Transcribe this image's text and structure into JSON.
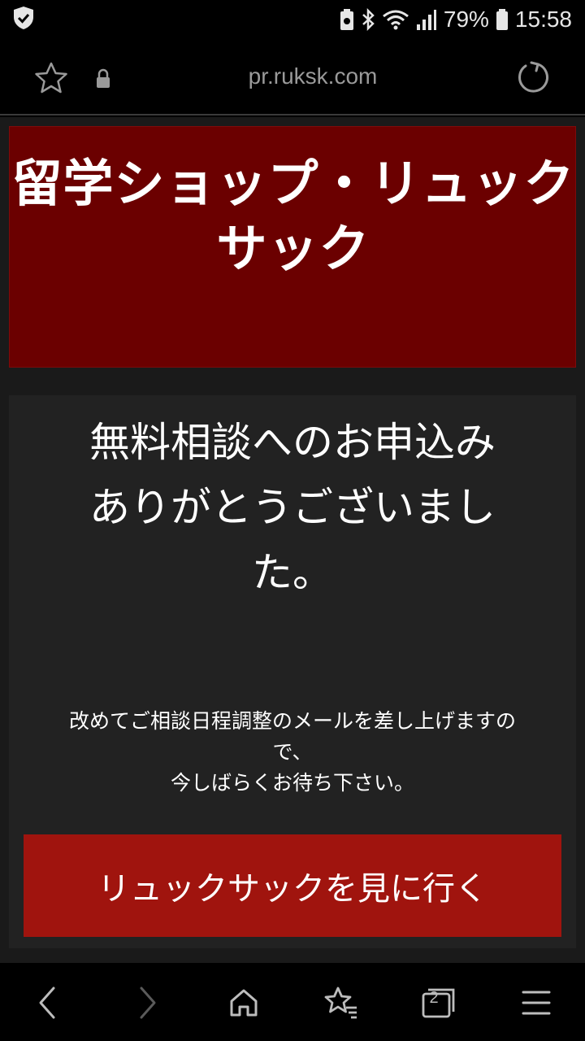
{
  "status_bar": {
    "battery_percent": "79%",
    "time": "15:58",
    "icons": [
      "shield-check-icon",
      "recycle-battery-icon",
      "bluetooth-icon",
      "wifi-icon",
      "signal-icon",
      "battery-icon"
    ]
  },
  "browser": {
    "url": "pr.ruksk.com",
    "icons": [
      "star-icon",
      "lock-icon",
      "reload-icon"
    ]
  },
  "page": {
    "hero_title_line1": "留学ショップ・リュック",
    "hero_title_line2": "サック",
    "thanks_line1": "無料相談へのお申込み",
    "thanks_line2": "ありがとうございまし",
    "thanks_line3": "た。",
    "notice_line1": "改めてご相談日程調整のメールを差し上げますの",
    "notice_line2": "で、",
    "notice_line3": "今しばらくお待ち下さい。",
    "cta_label": "リュックサックを見に行く"
  },
  "nav": {
    "tab_count": "2",
    "icons": [
      "back-icon",
      "forward-icon",
      "home-icon",
      "bookmarks-icon",
      "tabs-icon",
      "menu-icon"
    ]
  },
  "colors": {
    "hero_bg": "#6b0000",
    "cta_bg": "#a0140e",
    "card_bg": "#222222",
    "page_bg": "#1a1a1a"
  }
}
